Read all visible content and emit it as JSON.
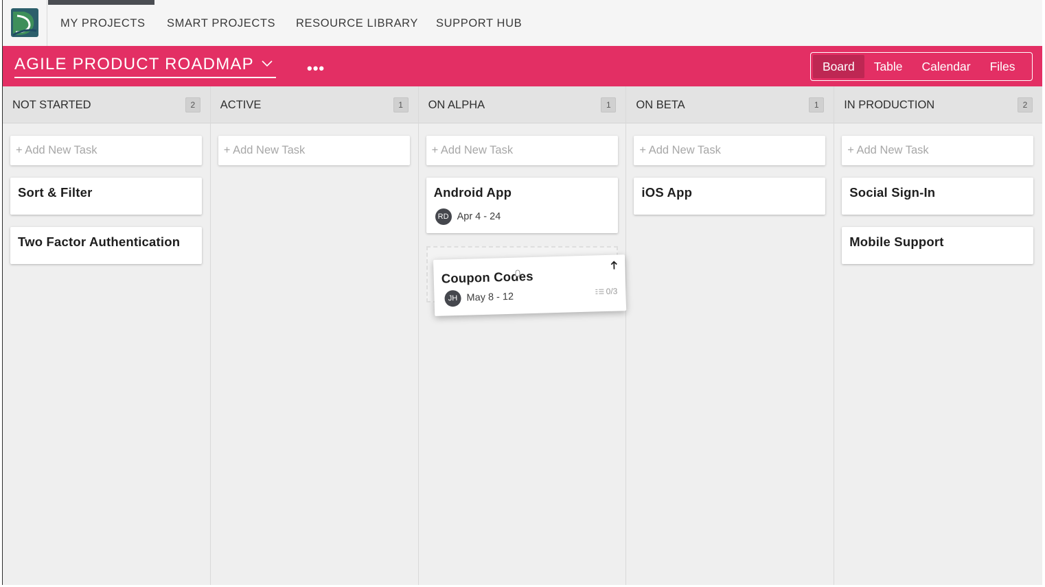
{
  "nav": {
    "items": [
      "MY PROJECTS",
      "SMART PROJECTS",
      "RESOURCE LIBRARY",
      "SUPPORT HUB"
    ],
    "active_index": 0
  },
  "project": {
    "title": "AGILE PRODUCT ROADMAP",
    "more": "•••",
    "views": [
      "Board",
      "Table",
      "Calendar",
      "Files"
    ],
    "active_view": "Board"
  },
  "colors": {
    "brand": "#e32f64",
    "active_view_bg": "#be2753",
    "avatar_bg": "#45474d"
  },
  "board": {
    "add_task_label": "+ Add New Task",
    "columns": [
      {
        "title": "NOT STARTED",
        "count": "2",
        "cards": [
          {
            "title": "Sort & Filter"
          },
          {
            "title": "Two Factor Authentication"
          }
        ]
      },
      {
        "title": "ACTIVE",
        "count": "1",
        "cards": []
      },
      {
        "title": "ON ALPHA",
        "count": "1",
        "cards": [
          {
            "title": "Android App",
            "avatar": "RD",
            "date": "Apr 4 - 24"
          }
        ]
      },
      {
        "title": "ON BETA",
        "count": "1",
        "cards": [
          {
            "title": "iOS App"
          }
        ]
      },
      {
        "title": "IN PRODUCTION",
        "count": "2",
        "cards": [
          {
            "title": "Social Sign-In"
          },
          {
            "title": "Mobile Support"
          }
        ]
      }
    ],
    "dragging_card": {
      "title": "Coupon Codes",
      "avatar": "JH",
      "date": "May 8 - 12",
      "subtasks": "0/3",
      "icon": "arrow-up-icon"
    }
  }
}
